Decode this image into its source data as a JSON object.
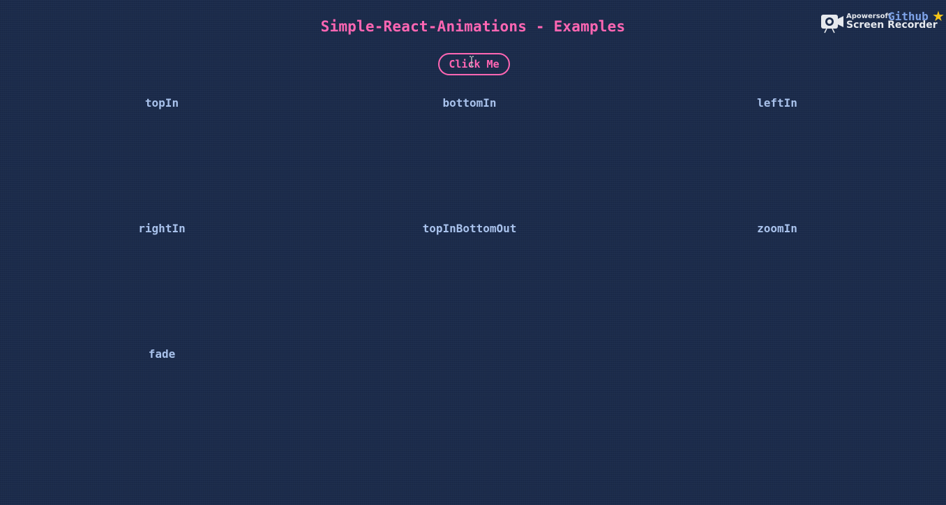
{
  "header": {
    "title": "Simple-React-Animations - Examples",
    "button_label": "Click Me"
  },
  "examples": [
    {
      "label": "topIn"
    },
    {
      "label": "bottomIn"
    },
    {
      "label": "leftIn"
    },
    {
      "label": "rightIn"
    },
    {
      "label": "topInBottomOut"
    },
    {
      "label": "zoomIn"
    },
    {
      "label": "fade"
    }
  ],
  "corner": {
    "github_label": "Github",
    "star_icon": "star-icon"
  },
  "watermark": {
    "brand": "Apowersoft",
    "product": "Screen Recorder",
    "icon": "camera-icon"
  },
  "colors": {
    "background": "#1b2b4b",
    "accent": "#ff66b3",
    "label": "#a9c2ec",
    "link": "#7ea3e8",
    "star": "#f5c518"
  }
}
